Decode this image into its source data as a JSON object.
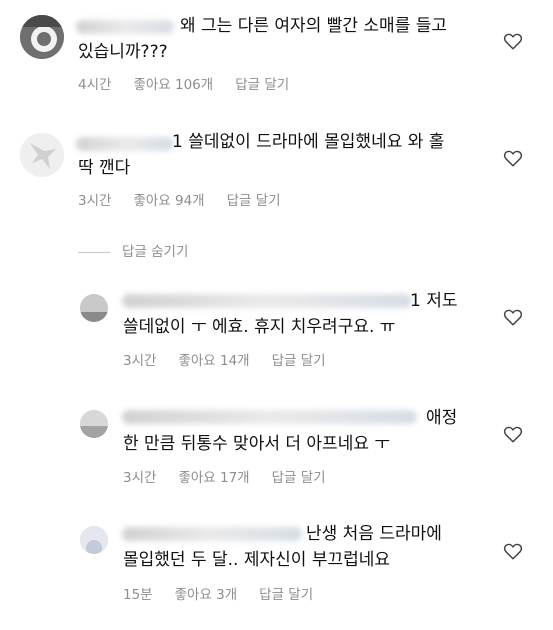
{
  "comments": [
    {
      "line1": "왜 그는 다른 여자의 빨간 소매를 들고",
      "line2": "있습니까???",
      "time": "4시간",
      "likes": "좋아요 106개",
      "reply": "답글 달기"
    },
    {
      "line1": "1 쓸데없이 드라마에 몰입했네요 와 홀",
      "line2": "딱 깬다",
      "time": "3시간",
      "likes": "좋아요 94개",
      "reply": "답글 달기"
    }
  ],
  "hide_replies": "답글 숨기기",
  "replies": [
    {
      "line1": "1 저도",
      "line2": "쓸데없이 ㅜ 에효. 휴지 치우려구요. ㅠ",
      "time": "3시간",
      "likes": "좋아요 14개",
      "reply": "답글 달기"
    },
    {
      "line1": "애정",
      "line2": "한 만큼 뒤통수 맞아서 더 아프네요 ㅜ",
      "time": "3시간",
      "likes": "좋아요 17개",
      "reply": "답글 달기"
    },
    {
      "line1": "난생 처음 드라마에",
      "line2": "몰입했던 두 달.. 제자신이 부끄럽네요",
      "time": "15분",
      "likes": "좋아요 3개",
      "reply": "답글 달기"
    }
  ],
  "icons": {
    "like": "heart-outline-icon"
  },
  "colors": {
    "text": "#111111",
    "meta": "#8e8e8e",
    "divider": "#c7c7c7"
  }
}
